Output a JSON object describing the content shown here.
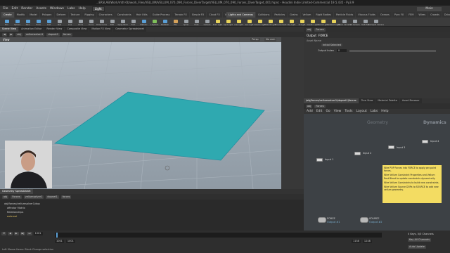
{
  "window": {
    "title": "...ERSLAB/Work/mtlt-0b/work_Files/VELLUM/VELLUM_070_090_Forces_DiverTarget/VELLUM_070_090_Forces_DiverTarget_001.hipnc - Houdini Indie Limited-Commercial 19.5.435 - Py3.9"
  },
  "menu": {
    "items": [
      "File",
      "Edit",
      "Render",
      "Assets",
      "Windows",
      "Labs",
      "Help"
    ],
    "desktop": "Light",
    "right_label": "Main"
  },
  "shelf_tabs_left": [
    "Create",
    "Modify",
    "Model",
    "Polygon",
    "Deform",
    "Texture",
    "Rigging",
    "Characters",
    "Constraints",
    "Hair Utils",
    "Guide Process",
    "Terrain FX",
    "Simple FX",
    "Cloud FX",
    "Volume"
  ],
  "shelf_tabs_right": [
    "Lights and Cameras",
    "Collisions",
    "Particles",
    "Grains",
    "Vellum",
    "Rigid Bodies",
    "Particle Fluids",
    "Viscous Fluids",
    "Oceans",
    "Pyro FX",
    "FEM",
    "Wires",
    "Crowds",
    "Drive Simulation"
  ],
  "shelf_tools": [
    {
      "label": "Box",
      "color": "#5a9fd6"
    },
    {
      "label": "Sphere",
      "color": "#5a9fd6"
    },
    {
      "label": "Tube",
      "color": "#5a9fd6"
    },
    {
      "label": "Torus",
      "color": "#5a9fd6"
    },
    {
      "label": "Grid",
      "color": "#5a9fd6"
    },
    {
      "label": "Null",
      "color": "#9aa0a6"
    },
    {
      "label": "Line",
      "color": "#9aa0a6"
    },
    {
      "label": "Circle",
      "color": "#9aa0a6"
    },
    {
      "label": "Curve",
      "color": "#9aa0a6"
    },
    {
      "label": "Draw Curve",
      "color": "#9aa0a6"
    },
    {
      "label": "Path",
      "color": "#9aa0a6"
    },
    {
      "label": "Spray Paint",
      "color": "#9aa0a6"
    },
    {
      "label": "Font",
      "color": "#9aa0a6"
    },
    {
      "label": "Platonic",
      "color": "#5a9fd6"
    },
    {
      "label": "L-System",
      "color": "#7fbf5a"
    },
    {
      "label": "Metaball",
      "color": "#5a9fd6"
    },
    {
      "label": "File",
      "color": "#d6a25a"
    },
    {
      "label": "Spiral",
      "color": "#9aa0a6"
    },
    {
      "label": "Helix",
      "color": "#9aa0a6"
    },
    {
      "label": "Camera",
      "color": "#9aa0a6"
    },
    {
      "label": "Point Light",
      "color": "#e8d35a"
    },
    {
      "label": "Spot Light",
      "color": "#e8d35a"
    },
    {
      "label": "Area Light",
      "color": "#e8d35a"
    },
    {
      "label": "Geo Light",
      "color": "#e8d35a"
    },
    {
      "label": "Volume Light",
      "color": "#e8d35a"
    },
    {
      "label": "Distant Light",
      "color": "#e8d35a"
    },
    {
      "label": "Environment",
      "color": "#e8d35a"
    },
    {
      "label": "Sky Light",
      "color": "#e8d35a"
    },
    {
      "label": "GI Light",
      "color": "#e8d35a"
    },
    {
      "label": "Caustic Light",
      "color": "#e8d35a"
    },
    {
      "label": "Portal Light",
      "color": "#e8d35a"
    },
    {
      "label": "Ambient Light",
      "color": "#e8d35a"
    },
    {
      "label": "Stereo Camera",
      "color": "#9aa0a6"
    },
    {
      "label": "VR Camera",
      "color": "#9aa0a6"
    },
    {
      "label": "Switcher",
      "color": "#9aa0a6"
    },
    {
      "label": "Gamepad Camera",
      "color": "#9aa0a6"
    }
  ],
  "left_pane_tabs": [
    "Scene View",
    "Animation Editor",
    "Render View",
    "Composite View",
    "Motion FX View",
    "Geometry Spreadsheet"
  ],
  "path": {
    "obj": "obj",
    "node1": "vellumsolver1",
    "node2": "dopnet1",
    "node3": "forces"
  },
  "viewport": {
    "label": "View",
    "persp": "Persp",
    "camera": "No cam"
  },
  "grid_color": "#35b3b8",
  "spread_tabs": [
    "Geometry Spreadsheet"
  ],
  "spread_path": {
    "obj": "obj",
    "node": "Forces",
    "n2": "vellumsolver1",
    "n3": "dopnet1",
    "n4": "forces"
  },
  "spread_tree": [
    "obj/forces/vellumsolver1/dop",
    "affector Matrix",
    "Relationships",
    "external"
  ],
  "right_top": {
    "path": {
      "obj": "obj",
      "node": "Forces"
    },
    "node_label": "Output",
    "node_name": "FORCE",
    "tab_label": "Asset Name",
    "field_label": "Output Index",
    "field_value": "0",
    "button": "Initial Selected"
  },
  "net_tabs": [
    "/obj/forces/vellumsolver1/dopnet1/forces",
    "Tree View",
    "Material Palette",
    "Asset Browser"
  ],
  "net_path": {
    "obj": "obj",
    "node": "Forces"
  },
  "net_menu": [
    "Add",
    "Edit",
    "Go",
    "View",
    "Tools",
    "Layout",
    "Labs",
    "Help"
  ],
  "net_title": "Dynamics",
  "net_title2": "Geometry",
  "nodes": [
    {
      "label": "Input 1"
    },
    {
      "label": "Input 2"
    },
    {
      "label": "Input 3"
    },
    {
      "label": "Input 4"
    }
  ],
  "outputs": [
    {
      "name": "FORCE",
      "sub": "Output #1"
    },
    {
      "name": "SOURCE",
      "sub": "Output #2"
    }
  ],
  "sticky": {
    "lines": [
      "Wire POP Forces into FORCE to apply per-point forces.",
      "Wire Vellum Constraint Properties and Vellum Rest Blend to update constraints dynamically.",
      "Wire Vellum Constraints to build new constraints.",
      "Wire Vellum Source DOPs to SOURCE to add new vellum geometry."
    ]
  },
  "timeline": {
    "frame": "1001",
    "start": "1001",
    "start2": "1001",
    "end": "1158",
    "end2": "1248",
    "keys_label": "0 Keys, 0/0 Channels",
    "key_all": "Key All Channels",
    "auto_update": "Auto Update",
    "status": "Left Mouse Items: Block Change selection"
  }
}
